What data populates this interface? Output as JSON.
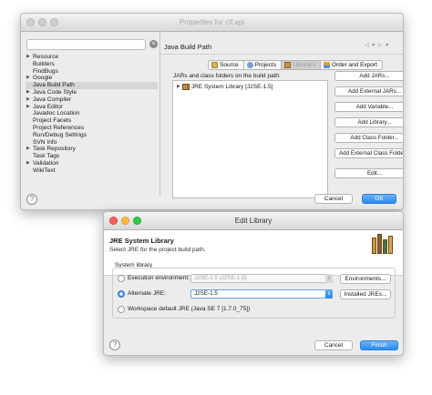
{
  "properties_dialog": {
    "title": "Properties for cif.api",
    "tree_items": [
      {
        "label": "Resource",
        "expandable": true
      },
      {
        "label": "Builders",
        "expandable": false
      },
      {
        "label": "FindBugs",
        "expandable": false
      },
      {
        "label": "Google",
        "expandable": true
      },
      {
        "label": "Java Build Path",
        "expandable": false,
        "selected": true
      },
      {
        "label": "Java Code Style",
        "expandable": true
      },
      {
        "label": "Java Compiler",
        "expandable": true
      },
      {
        "label": "Java Editor",
        "expandable": true
      },
      {
        "label": "Javadoc Location",
        "expandable": false
      },
      {
        "label": "Project Facets",
        "expandable": false
      },
      {
        "label": "Project References",
        "expandable": false
      },
      {
        "label": "Run/Debug Settings",
        "expandable": false
      },
      {
        "label": "SVN Info",
        "expandable": false
      },
      {
        "label": "Task Repository",
        "expandable": true
      },
      {
        "label": "Task Tags",
        "expandable": false
      },
      {
        "label": "Validation",
        "expandable": true
      },
      {
        "label": "WikiText",
        "expandable": false
      }
    ],
    "pane_title": "Java Build Path",
    "nav_arrows": "◁ ▾ ▷ ▾",
    "tabs": [
      {
        "label": "Source",
        "icon": "source-folder-icon"
      },
      {
        "label": "Projects",
        "icon": "projects-icon"
      },
      {
        "label": "Libraries",
        "icon": "libraries-icon",
        "active": true
      },
      {
        "label": "Order and Export",
        "icon": "order-export-icon"
      }
    ],
    "list_label": "JARs and class folders on the build path:",
    "library_entry": "JRE System Library [J2SE-1.5]",
    "side_buttons": [
      "Add JARs...",
      "Add External JARs...",
      "Add Variable...",
      "Add Library...",
      "Add Class Folder...",
      "Add External Class Folder...",
      "Edit..."
    ],
    "help_symbol": "?",
    "cancel_label": "Cancel",
    "ok_label": "OK"
  },
  "edit_library_dialog": {
    "title": "Edit Library",
    "heading": "JRE System Library",
    "subheading": "Select JRE for the project build path.",
    "group_label": "System library",
    "options": {
      "execution_env_label": "Execution environment:",
      "execution_env_value": "J2SE-1.5 (J2SE-1.5)",
      "environments_button": "Environments...",
      "alternate_jre_label": "Alternate JRE:",
      "alternate_jre_value": "J2SE-1.5",
      "installed_jres_button": "Installed JREs...",
      "workspace_default_label": "Workspace default JRE (Java SE 7 [1.7.0_75])"
    },
    "selected_option": "alternate_jre",
    "help_symbol": "?",
    "cancel_label": "Cancel",
    "finish_label": "Finish"
  },
  "colors": {
    "accent_blue": "#2a8bf2",
    "window_bg": "#ececec",
    "traffic_red": "#fc605c",
    "traffic_yellow": "#fdbc40",
    "traffic_green": "#34c84a"
  }
}
